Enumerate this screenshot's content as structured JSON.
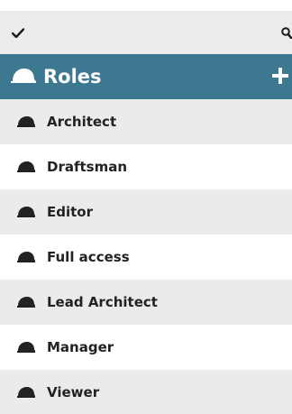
{
  "toolbar": {
    "check_icon": "checkmark-icon",
    "search_icon": "search-icon"
  },
  "header": {
    "title": "Roles",
    "icon": "hard-hat-icon",
    "add_icon": "plus-icon",
    "background": "#3d7891"
  },
  "roles": [
    {
      "label": "Architect",
      "icon": "hard-hat-icon"
    },
    {
      "label": "Draftsman",
      "icon": "hard-hat-icon"
    },
    {
      "label": "Editor",
      "icon": "hard-hat-icon"
    },
    {
      "label": "Full access",
      "icon": "hard-hat-icon"
    },
    {
      "label": "Lead Architect",
      "icon": "hard-hat-icon"
    },
    {
      "label": "Manager",
      "icon": "hard-hat-icon"
    },
    {
      "label": "Viewer",
      "icon": "hard-hat-icon"
    }
  ]
}
